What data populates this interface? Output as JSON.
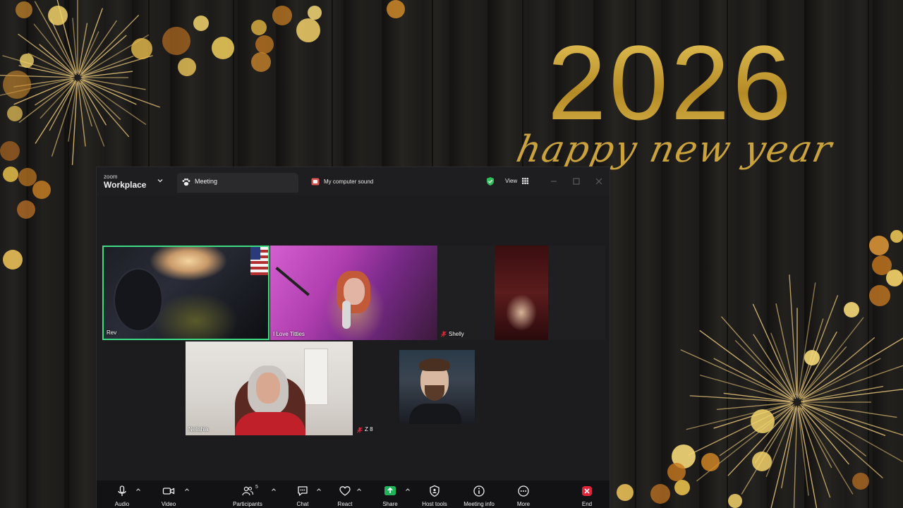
{
  "wallpaper": {
    "year": "2026",
    "subtitle": "happy new year",
    "accent_color": "#c8a33a"
  },
  "zoom": {
    "brand_small": "zoom",
    "brand_big": "Workplace",
    "meeting_tab_label": "Meeting",
    "audio_source_label": "My computer sound",
    "view_label": "View",
    "icons": {
      "brand_chevron": "chevron-down-icon",
      "meeting_tab": "paw-icon",
      "audio_source": "audio-share-icon",
      "security": "shield-check-icon",
      "view": "grid-icon"
    }
  },
  "participants": [
    {
      "name": "Rev",
      "active_speaker": true,
      "muted": false
    },
    {
      "name": "I Love Titties",
      "active_speaker": false,
      "muted": false
    },
    {
      "name": "Shelly",
      "active_speaker": false,
      "muted": true
    },
    {
      "name": "Nelishia",
      "active_speaker": false,
      "muted": false
    },
    {
      "name": "Z 8",
      "active_speaker": false,
      "muted": true
    }
  ],
  "controls": {
    "audio": "Audio",
    "video": "Video",
    "participants": "Participants",
    "participants_count": "5",
    "chat": "Chat",
    "react": "React",
    "share": "Share",
    "host_tools": "Host tools",
    "meeting_info": "Meeting info",
    "more": "More",
    "end": "End"
  },
  "colors": {
    "active_speaker_border": "#3ddc84",
    "share_green": "#1fb35a",
    "end_red": "#e0243a",
    "mute_red": "#e0243a"
  }
}
